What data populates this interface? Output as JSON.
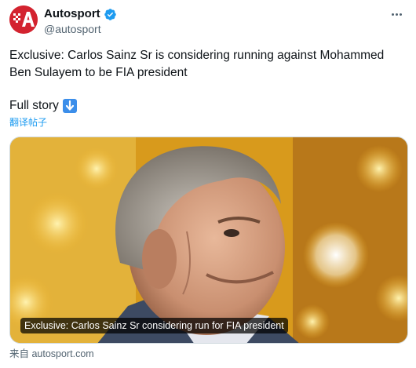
{
  "account": {
    "name": "Autosport",
    "handle": "@autosport"
  },
  "tweet": {
    "text": "Exclusive: Carlos Sainz Sr is considering running against Mohammed Ben Sulayem to be FIA president",
    "full_story": "Full story",
    "translate": "翻译帖子"
  },
  "card": {
    "caption": "Exclusive: Carlos Sainz Sr considering run for FIA president",
    "source": "来自 autosport.com"
  },
  "colors": {
    "brand_red": "#d3232f",
    "link_blue": "#1d9bf0",
    "verified_blue": "#1d9bf0"
  },
  "icons": [
    "autosport-logo",
    "verified-badge-icon",
    "more-options-icon",
    "down-arrow-icon"
  ]
}
